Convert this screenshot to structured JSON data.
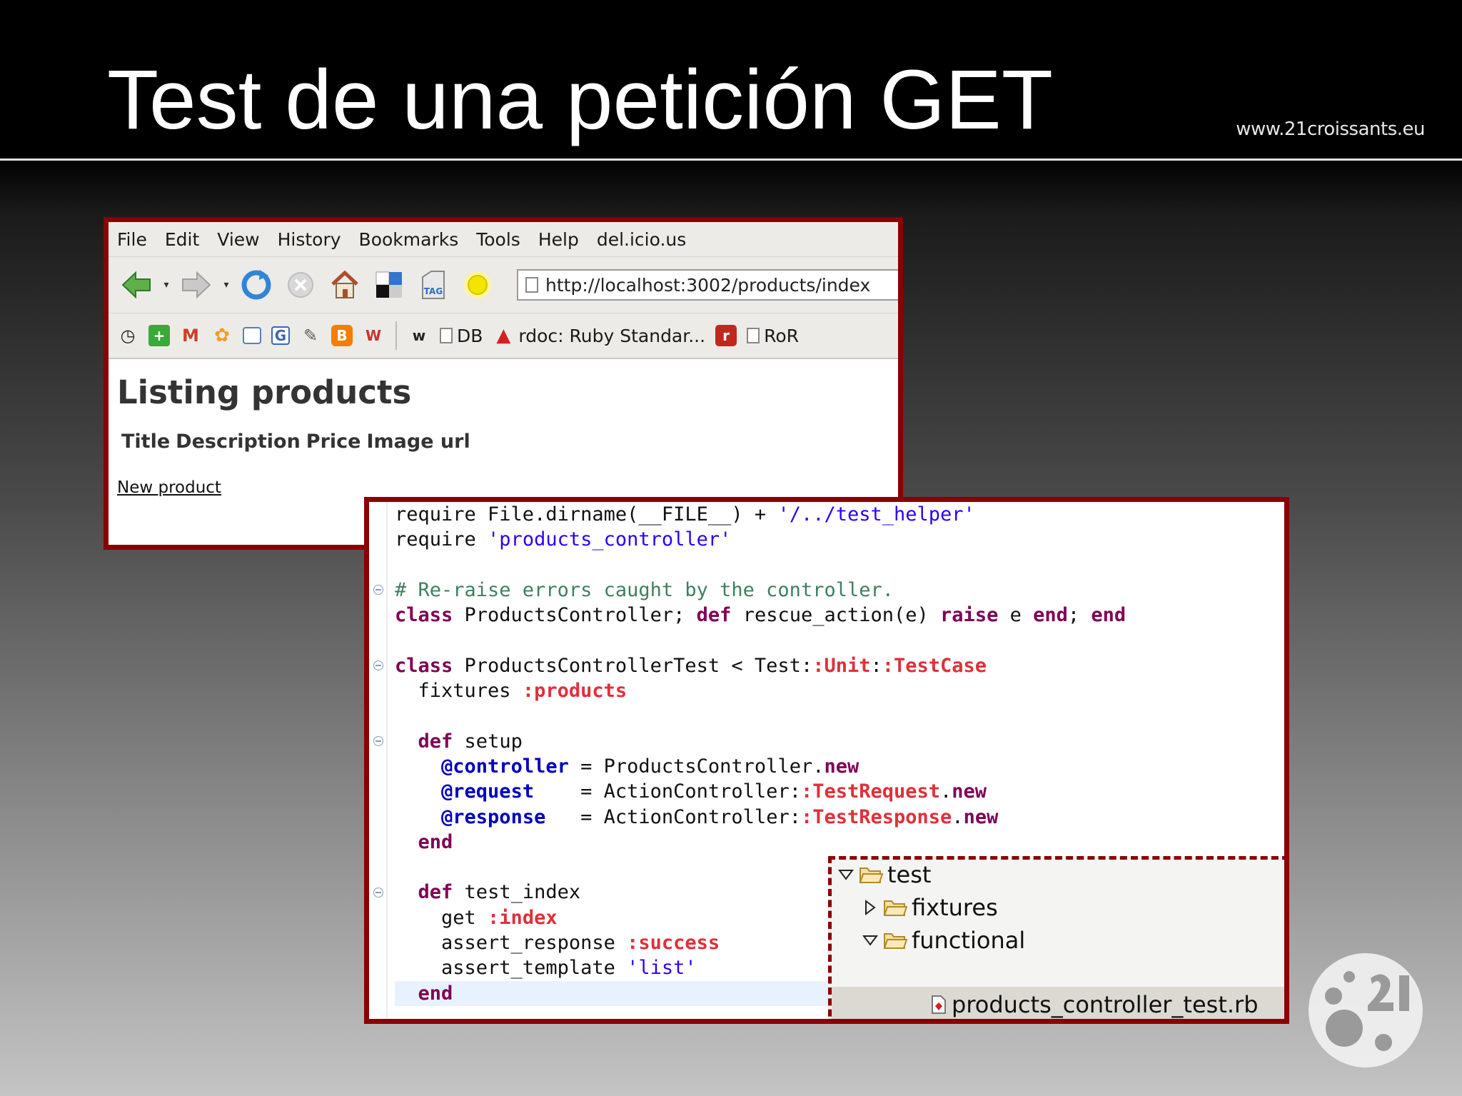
{
  "slide": {
    "title": "Test de una petición GET",
    "site_url": "www.21croissants.eu"
  },
  "browser": {
    "menu": [
      "File",
      "Edit",
      "View",
      "History",
      "Bookmarks",
      "Tools",
      "Help",
      "del.icio.us"
    ],
    "url": "http://localhost:3002/products/index",
    "nav_icons": [
      "back-arrow-icon",
      "forward-arrow-icon",
      "reload-icon",
      "stop-icon",
      "home-icon",
      "delicious-icon",
      "tag-icon",
      "sun-icon"
    ],
    "bookmarks": {
      "db": "DB",
      "rdoc": "rdoc: Ruby Standar...",
      "ror": "RoR"
    },
    "page": {
      "heading": "Listing products",
      "columns": [
        "Title",
        "Description",
        "Price",
        "Image url"
      ],
      "new_link": "New product"
    }
  },
  "editor": {
    "lines": [
      "require File.dirname(__FILE__) + '/../test_helper'",
      "require 'products_controller'",
      "",
      "# Re-raise errors caught by the controller.",
      "class ProductsController; def rescue_action(e) raise e end; end",
      "",
      "class ProductsControllerTest < Test::Unit::TestCase",
      "  fixtures :products",
      "",
      "  def setup",
      "    @controller = ProductsController.new",
      "    @request    = ActionController::TestRequest.new",
      "    @response   = ActionController::TestResponse.new",
      "  end",
      "",
      "  def test_index",
      "    get :index",
      "    assert_response :success",
      "    assert_template 'list'",
      "  end"
    ]
  },
  "tree": {
    "items": [
      "test",
      "fixtures",
      "functional",
      "products_controller_test.rb"
    ]
  },
  "colors": {
    "frame": "#8b0000",
    "keyword": "#7f0055",
    "string": "#2a00ff",
    "comment": "#3f7f5f",
    "symbol": "#e0303a",
    "ivar": "#0000c0"
  }
}
